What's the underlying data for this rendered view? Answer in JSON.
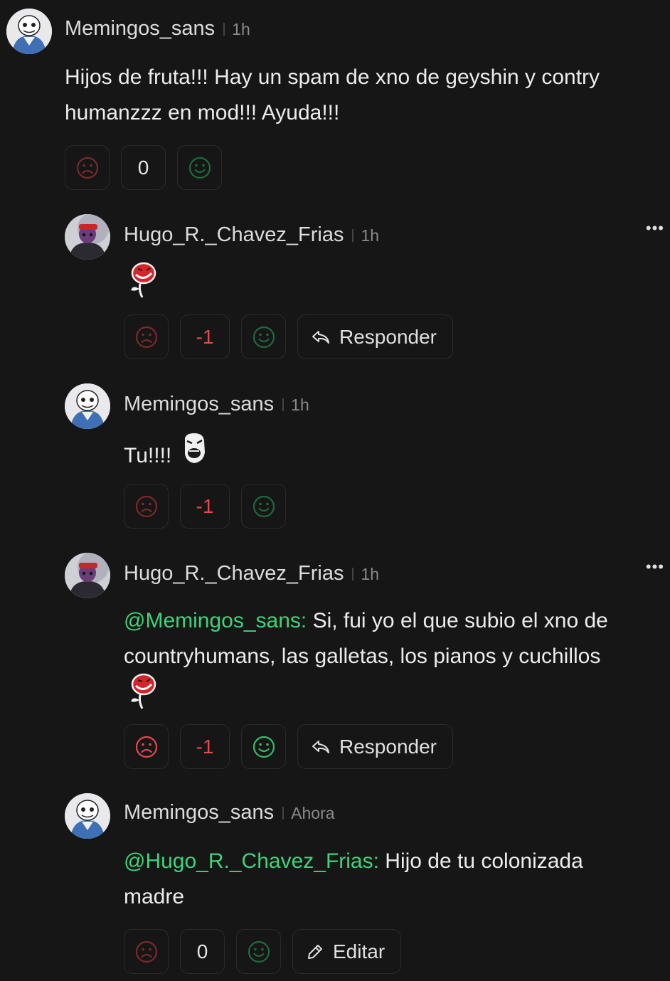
{
  "comments": [
    {
      "username": "Memingos_sans",
      "time": "1h",
      "text": "Hijos de fruta!!! Hay un spam de xno de geyshin y contry humanzzz en mod!!! Ayuda!!!",
      "score": "0",
      "avatar": "sans-avatar"
    },
    {
      "username": "Hugo_R._Chavez_Frias",
      "time": "1h",
      "sticker": "trollface-rose-sticker",
      "score": "-1",
      "reply_label": "Responder",
      "more_label": "•••",
      "avatar": "countryhuman-avatar"
    },
    {
      "username": "Memingos_sans",
      "time": "1h",
      "text": "Tu!!!!",
      "sticker": "rage-face-sticker",
      "score": "-1",
      "avatar": "sans-avatar"
    },
    {
      "username": "Hugo_R._Chavez_Frias",
      "time": "1h",
      "mention": "@Memingos_sans:",
      "text": " Si, fui yo el que subio el xno de countryhumans, las galletas, los pianos y cuchillos",
      "sticker": "trollface-rose-sticker",
      "score": "-1",
      "reply_label": "Responder",
      "more_label": "•••",
      "avatar": "countryhuman-avatar"
    },
    {
      "username": "Memingos_sans",
      "time": "Ahora",
      "mention": "@Hugo_R._Chavez_Frias:",
      "text": " Hijo de tu colonizada madre",
      "score": "0",
      "edit_label": "Editar",
      "avatar": "sans-avatar"
    }
  ],
  "colors": {
    "background": "#161616",
    "mention": "#3ed37a",
    "downvote": "#e5484d",
    "upvote": "#2fbf6a",
    "downvote_dim": "#7a2a2c",
    "upvote_dim": "#1f6a3e"
  }
}
